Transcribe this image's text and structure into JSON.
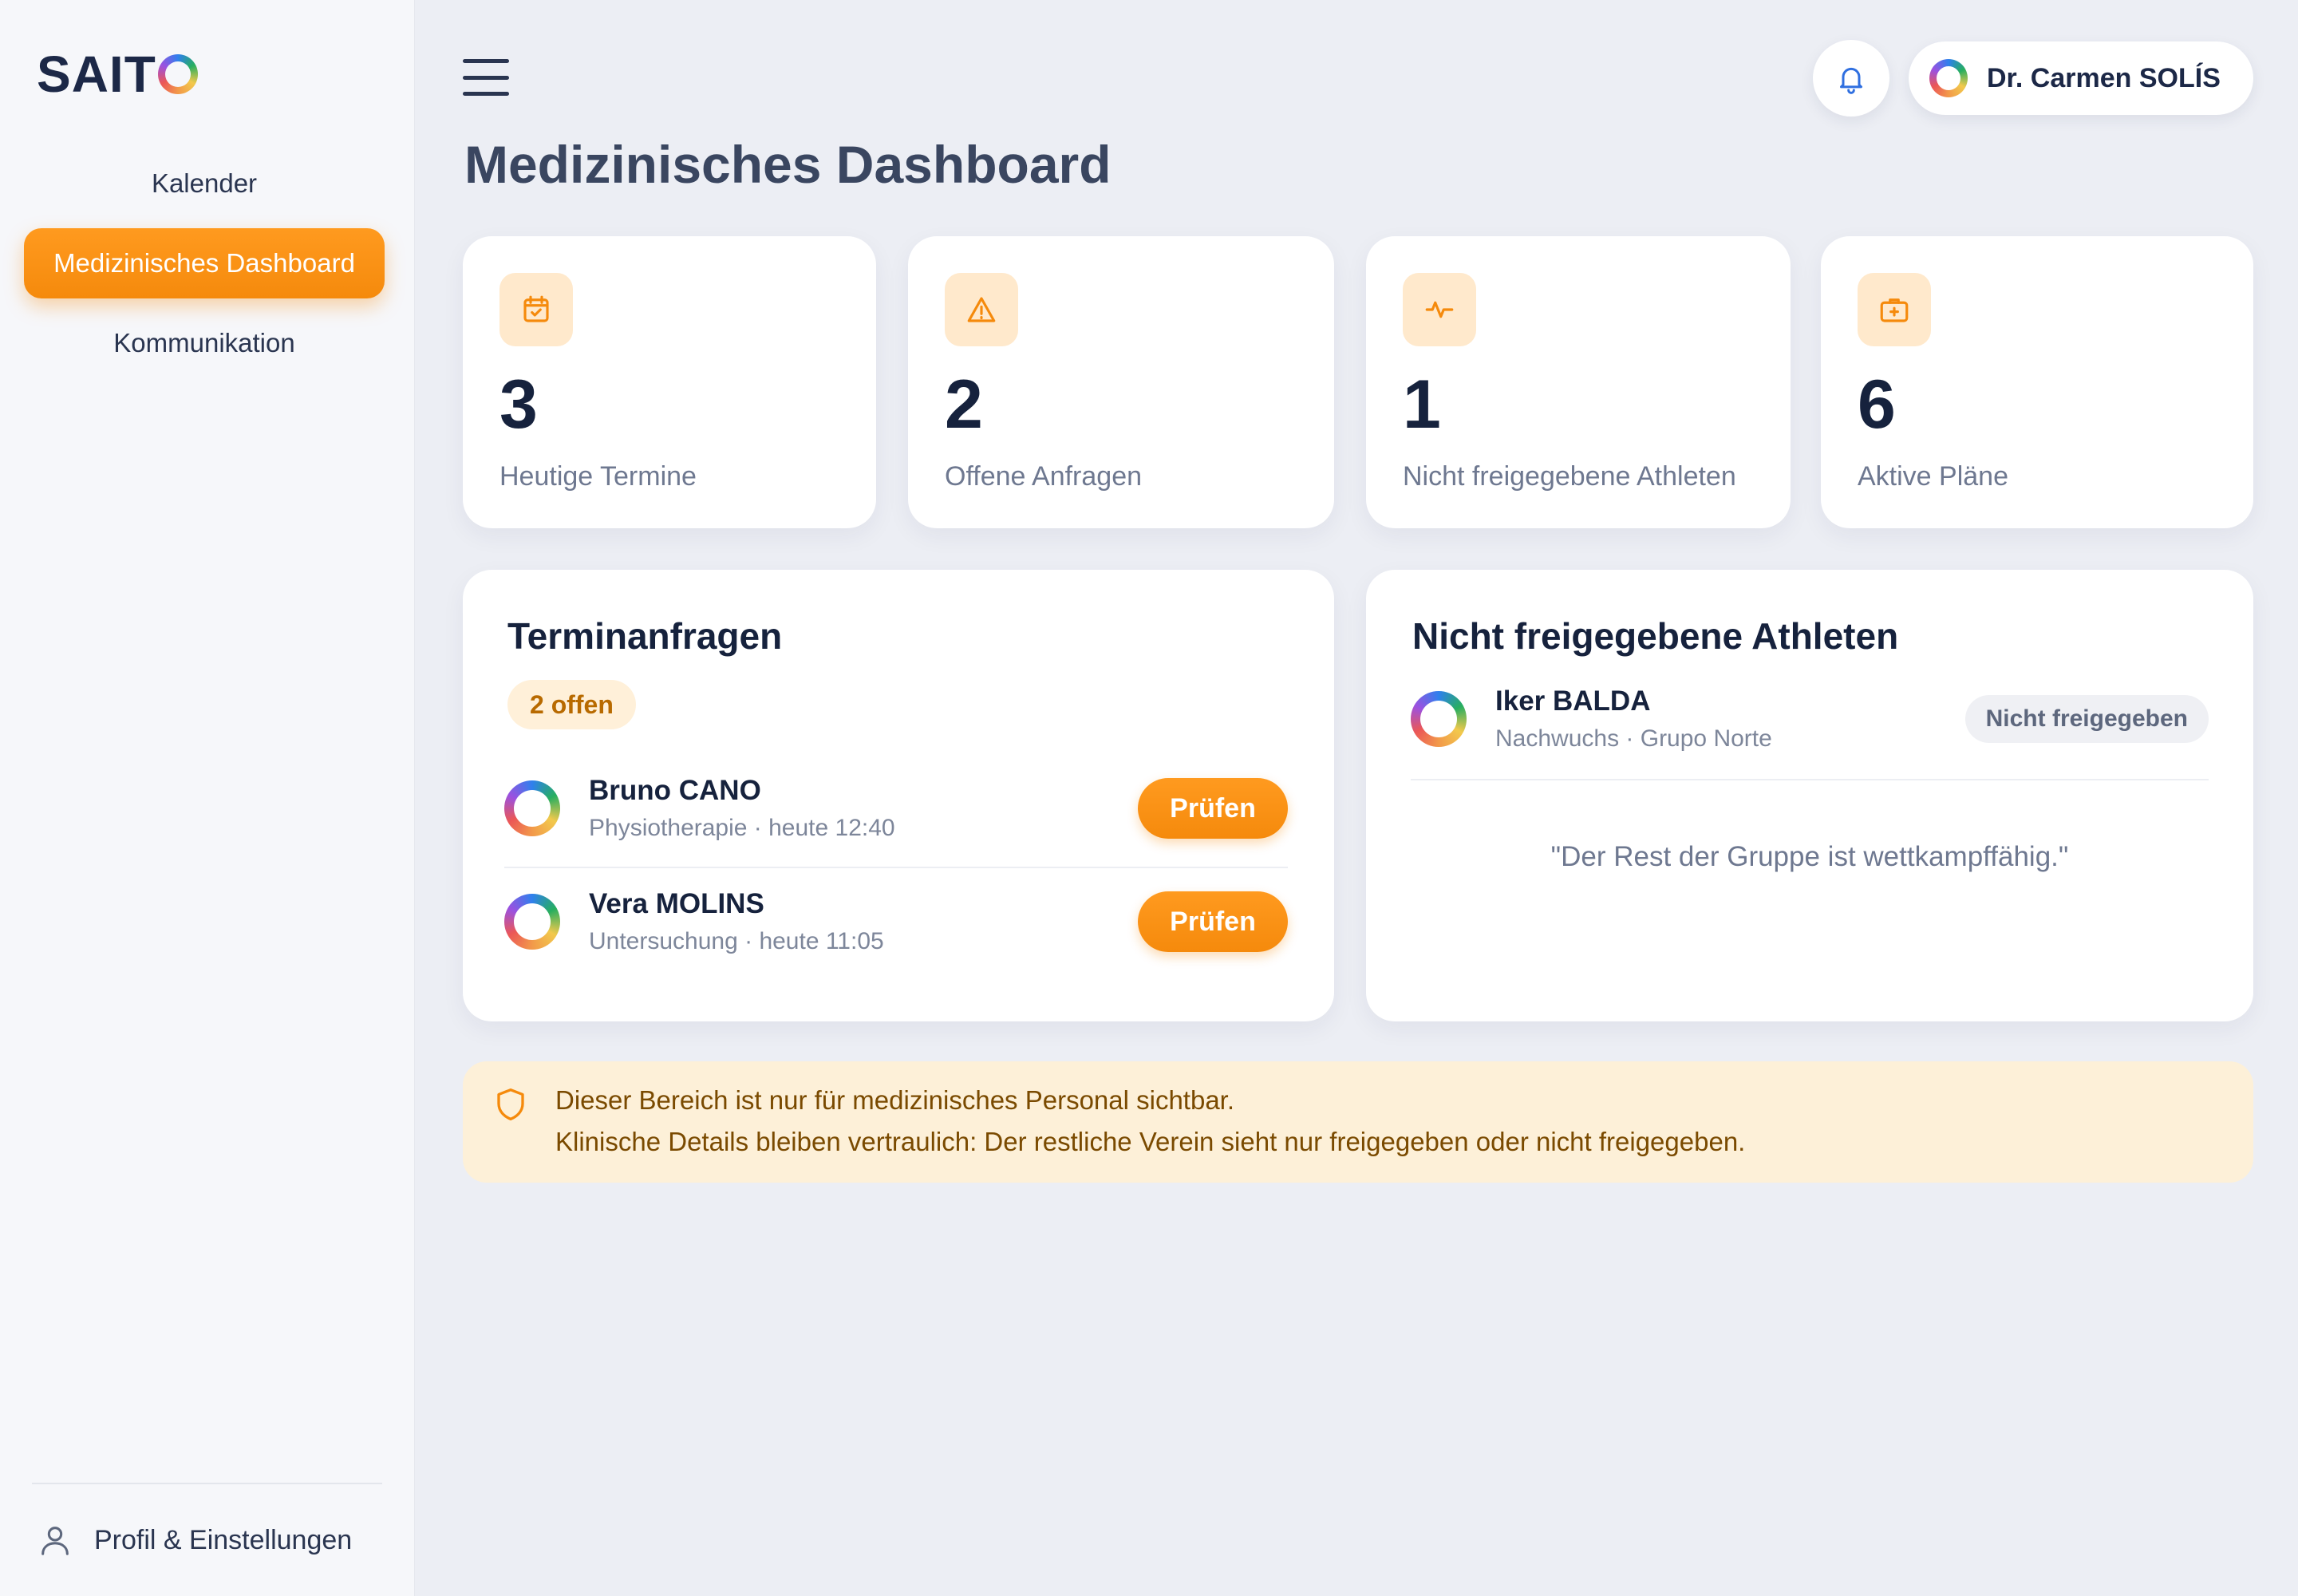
{
  "app": {
    "logo_text": "SAITO"
  },
  "sidebar": {
    "items": [
      {
        "label": "Kalender",
        "active": false
      },
      {
        "label": "Medizinisches Dashboard",
        "active": true
      },
      {
        "label": "Kommunikation",
        "active": false
      }
    ],
    "profile_label": "Profil & Einstellungen"
  },
  "header": {
    "user_name": "Dr. Carmen SOLÍS",
    "icons": [
      "menu-icon",
      "bell-icon",
      "user-avatar-ring"
    ]
  },
  "main": {
    "page_title": "Medizinisches Dashboard",
    "stats": [
      {
        "value": "3",
        "label": "Heutige Termine",
        "icon": "calendar-check-icon"
      },
      {
        "value": "2",
        "label": "Offene Anfragen",
        "icon": "warning-triangle-icon"
      },
      {
        "value": "1",
        "label": "Nicht freigegebene Athleten",
        "icon": "pulse-icon"
      },
      {
        "value": "6",
        "label": "Aktive Pläne",
        "icon": "medical-kit-icon"
      }
    ],
    "requests": {
      "title": "Terminanfragen",
      "badge": "2 offen",
      "items": [
        {
          "name": "Bruno CANO",
          "detail": "Physiotherapie · heute 12:40",
          "action": "Prüfen"
        },
        {
          "name": "Vera MOLINS",
          "detail": "Untersuchung · heute 11:05",
          "action": "Prüfen"
        }
      ]
    },
    "athletes": {
      "title": "Nicht freigegebene Athleten",
      "items": [
        {
          "name": "Iker BALDA",
          "detail": "Nachwuchs · Grupo Norte",
          "status": "Nicht freigegeben"
        }
      ],
      "note": "\"Der Rest der Gruppe ist wettkampffähig.\""
    },
    "notice": {
      "line1": "Dieser Bereich ist nur für medizinisches Personal sichtbar.",
      "line2": "Klinische Details bleiben vertraulich: Der restliche Verein sieht nur freigegeben oder nicht freigegeben.",
      "icon": "shield-icon"
    }
  },
  "colors": {
    "accent": "#f7900f",
    "accent_soft": "#ffe9cc",
    "background": "#eceef4",
    "notice_bg": "#fdf0d8",
    "text_dark": "#16223d"
  }
}
